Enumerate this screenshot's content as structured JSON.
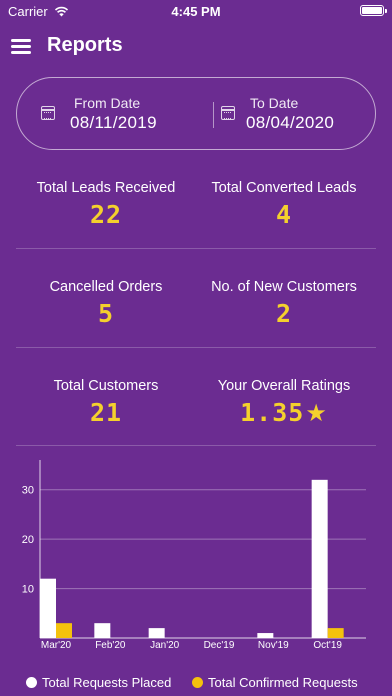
{
  "status_bar": {
    "carrier": "Carrier",
    "time": "4:45 PM"
  },
  "nav": {
    "title": "Reports"
  },
  "date_range": {
    "from_label": "From Date",
    "from_value": "08/11/2019",
    "to_label": "To Date",
    "to_value": "08/04/2020"
  },
  "stats": {
    "leads_received": {
      "label": "Total Leads Received",
      "value": "22"
    },
    "converted_leads": {
      "label": "Total Converted Leads",
      "value": "4"
    },
    "cancelled_orders": {
      "label": "Cancelled Orders",
      "value": "5"
    },
    "new_customers": {
      "label": "No. of New Customers",
      "value": "2"
    },
    "total_customers": {
      "label": "Total Customers",
      "value": "21"
    },
    "overall_ratings": {
      "label": "Your Overall Ratings",
      "value": "1.35"
    }
  },
  "colors": {
    "background": "#6b2c91",
    "accent": "#f4d02d",
    "placed": "#ffffff",
    "confirmed": "#f4c20d"
  },
  "chart_data": {
    "type": "bar",
    "categories": [
      "Mar'20",
      "Feb'20",
      "Jan'20",
      "Dec'19",
      "Nov'19",
      "Oct'19"
    ],
    "series": [
      {
        "name": "Total Requests Placed",
        "values": [
          12,
          3,
          2,
          0,
          1,
          32
        ]
      },
      {
        "name": "Total Confirmed Requests",
        "values": [
          3,
          0,
          0,
          0,
          0,
          2
        ]
      }
    ],
    "y_ticks": [
      10,
      20,
      30
    ],
    "ylim": [
      0,
      35
    ],
    "grid": "horizontal",
    "legend_position": "bottom"
  }
}
